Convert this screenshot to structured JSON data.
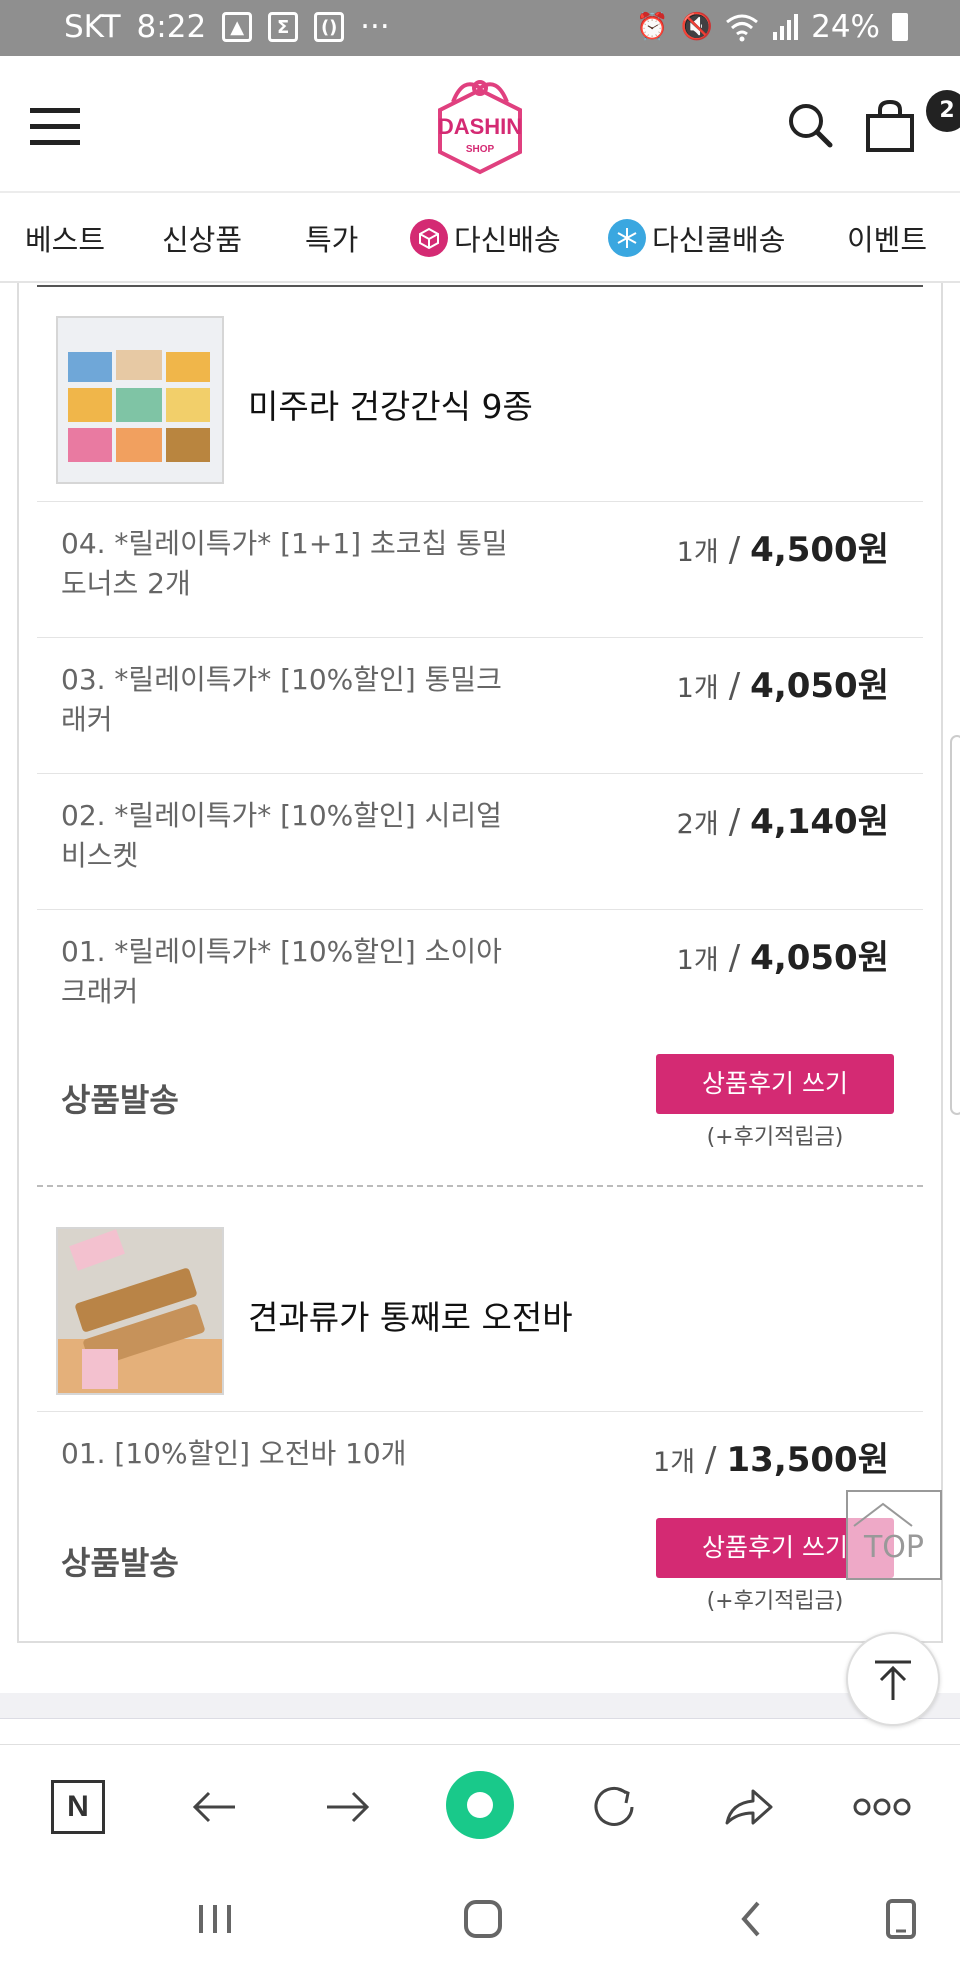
{
  "status_bar": {
    "carrier": "SKT",
    "time": "8:22",
    "more": "···",
    "battery": "24%"
  },
  "header": {
    "logo_text": "DASHIN",
    "logo_sub": "SHOP",
    "cart_count": "2"
  },
  "nav": {
    "items": [
      "베스트",
      "신상품",
      "특가",
      "다신배송",
      "다신쿨배송",
      "이벤트"
    ]
  },
  "orders": [
    {
      "title": "미주라 건강간식 9종",
      "items": [
        {
          "name": "04. *릴레이특가* [1+1] 초코칩 통밀도너츠 2개",
          "qty": "1개",
          "sep": "/",
          "price": "4,500원"
        },
        {
          "name": "03. *릴레이특가* [10%할인] 통밀크래커",
          "qty": "1개",
          "sep": "/",
          "price": "4,050원"
        },
        {
          "name": "02. *릴레이특가* [10%할인] 시리얼 비스켓",
          "qty": "2개",
          "sep": "/",
          "price": "4,140원"
        },
        {
          "name": "01. *릴레이특가* [10%할인] 소이아크래커",
          "qty": "1개",
          "sep": "/",
          "price": "4,050원"
        }
      ],
      "status": "상품발송",
      "review_button": "상품후기 쓰기",
      "review_note": "(+후기적립금)"
    },
    {
      "title": "견과류가 통째로 오전바",
      "items": [
        {
          "name": "01. [10%할인] 오전바 10개",
          "qty": "1개",
          "sep": "/",
          "price": "13,500원"
        }
      ],
      "status": "상품발송",
      "review_button": "상품후기 쓰기",
      "review_note": "(+후기적립금)"
    }
  ],
  "floating": {
    "top_label": "TOP"
  },
  "toolbar": {
    "naver_label": "N"
  },
  "colors": {
    "accent": "#d42a73",
    "status_bar": "#8f8f8f",
    "green": "#19c98a"
  }
}
